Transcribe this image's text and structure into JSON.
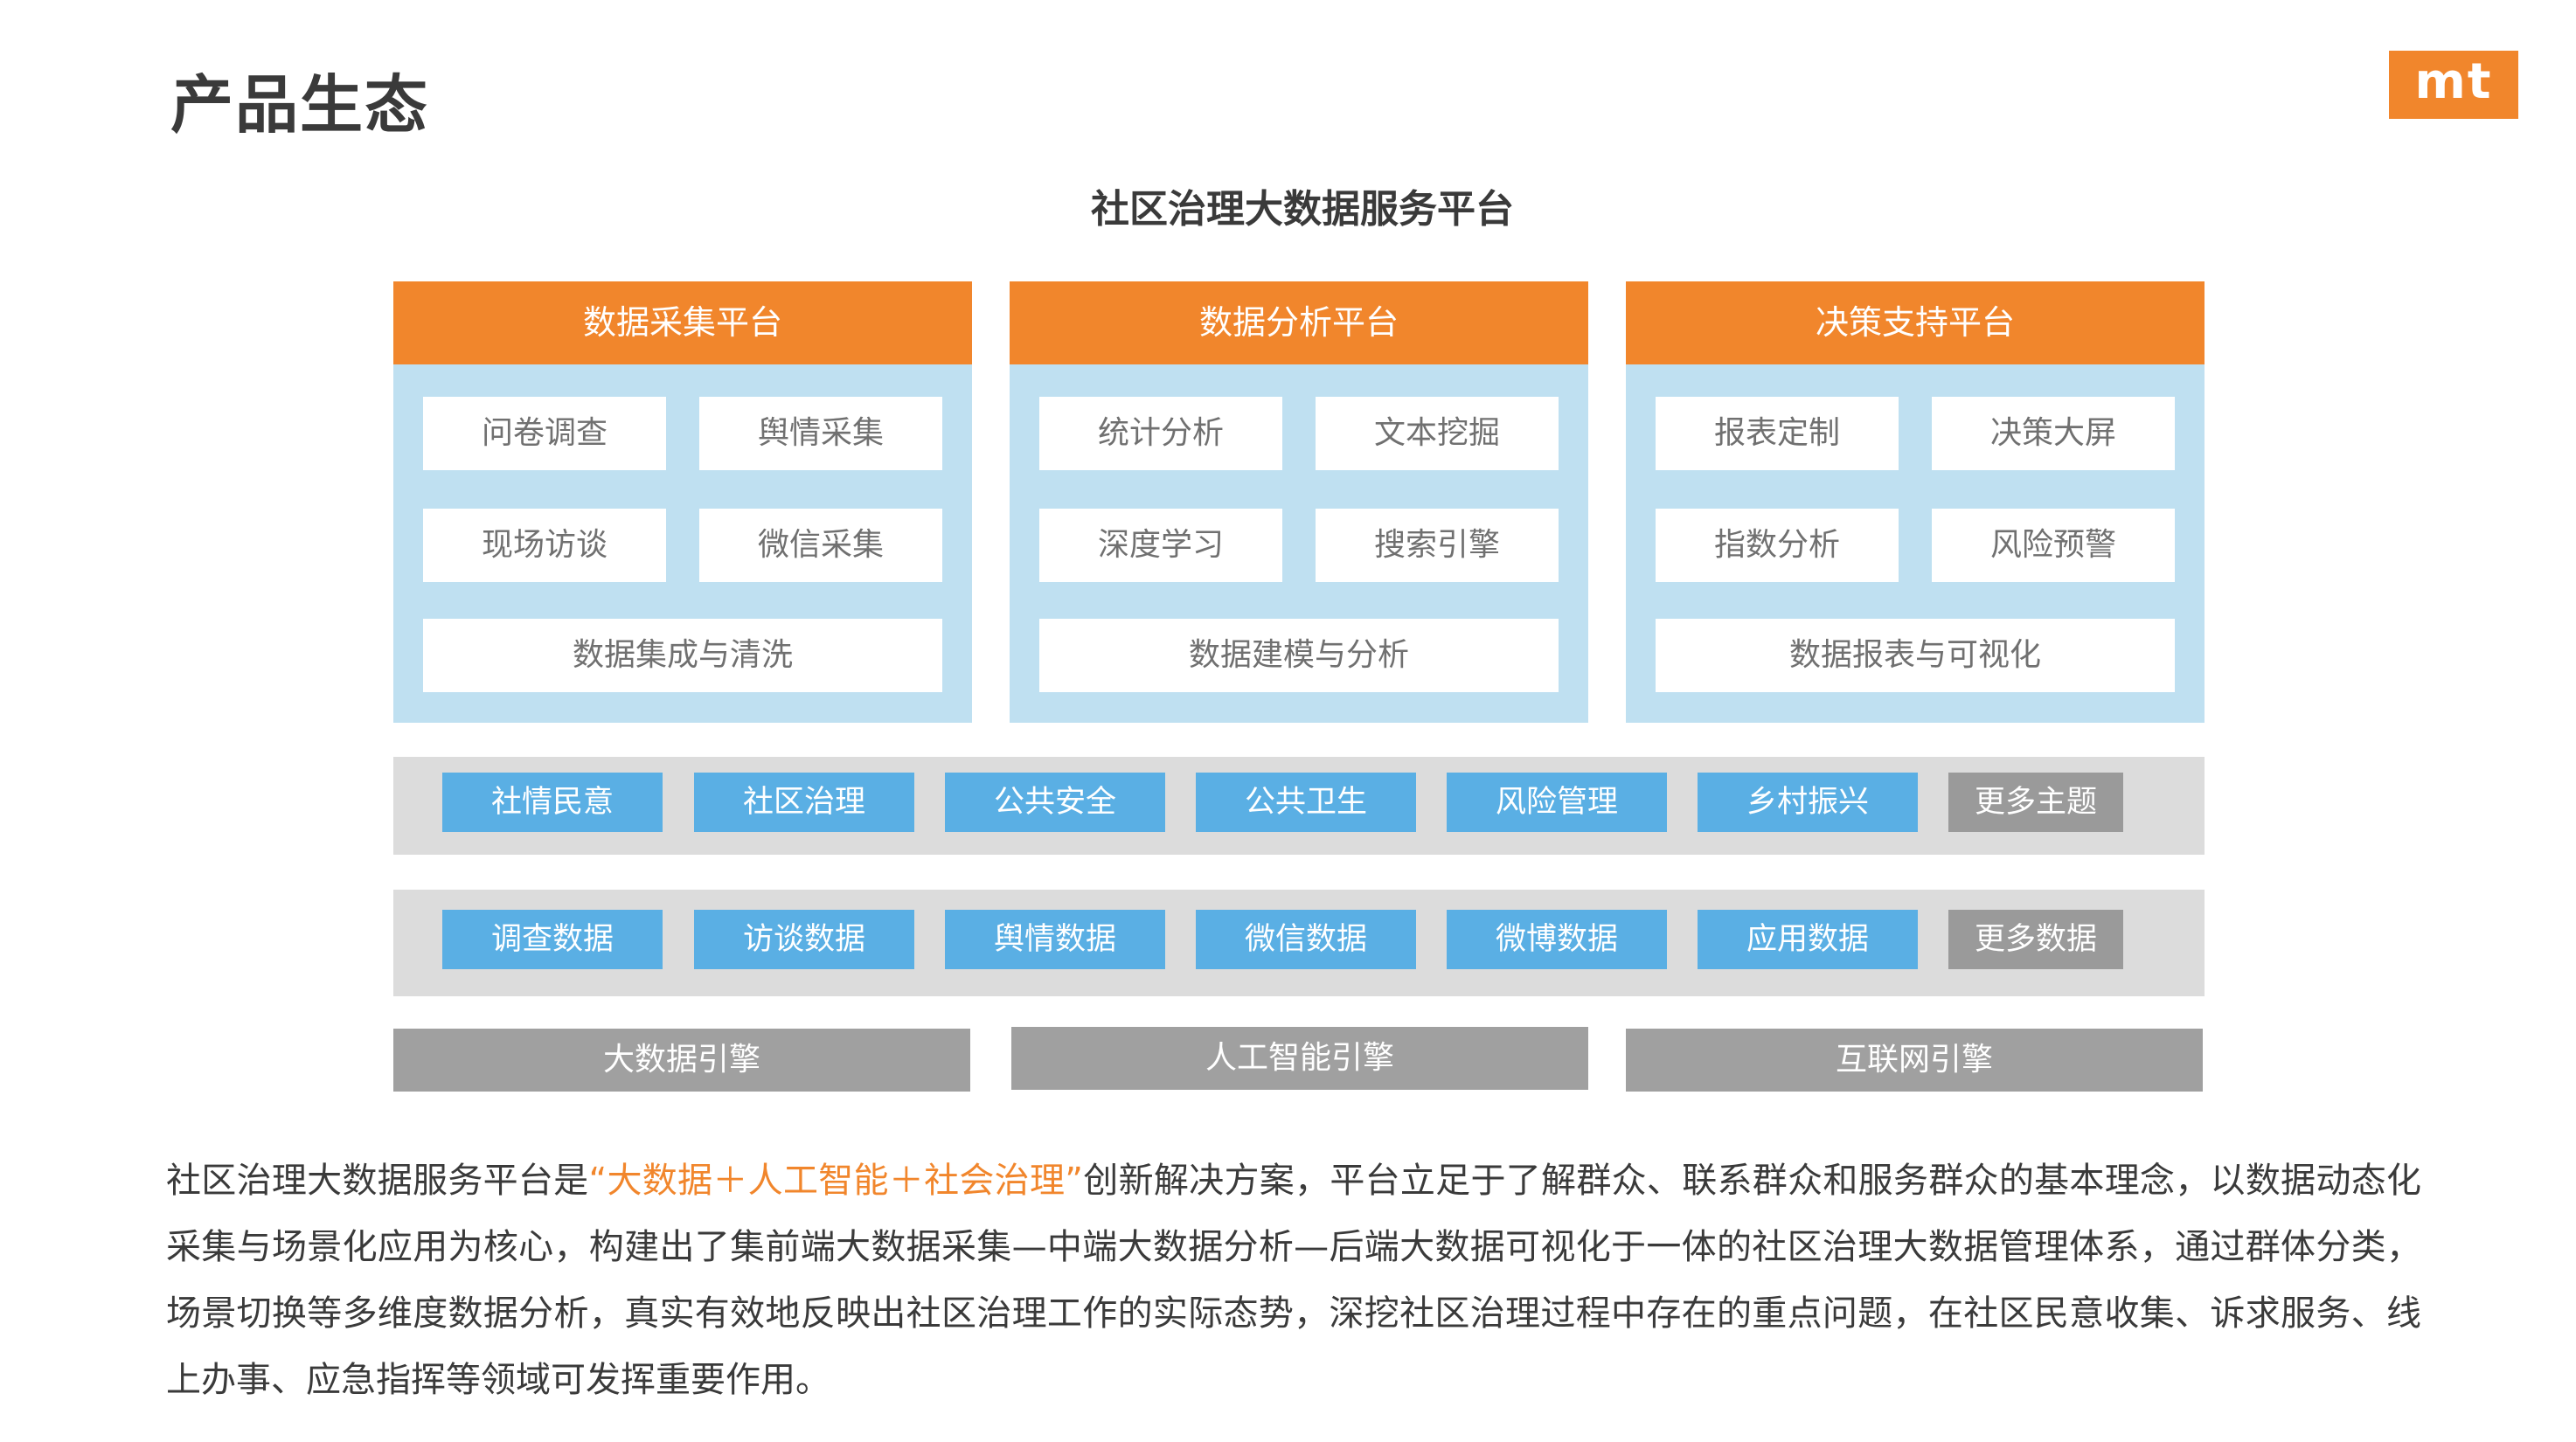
{
  "page_title": "产品生态",
  "logo_text": "mt",
  "diagram_title": "社区治理大数据服务平台",
  "platforms": [
    {
      "title": "数据采集平台",
      "items": [
        "问卷调查",
        "舆情采集",
        "现场访谈",
        "微信采集"
      ],
      "wide_item": "数据集成与清洗"
    },
    {
      "title": "数据分析平台",
      "items": [
        "统计分析",
        "文本挖掘",
        "深度学习",
        "搜索引擎"
      ],
      "wide_item": "数据建模与分析"
    },
    {
      "title": "决策支持平台",
      "items": [
        "报表定制",
        "决策大屏",
        "指数分析",
        "风险预警"
      ],
      "wide_item": "数据报表与可视化"
    }
  ],
  "topics": [
    "社情民意",
    "社区治理",
    "公共安全",
    "公共卫生",
    "风险管理",
    "乡村振兴",
    "更多主题"
  ],
  "data_sources": [
    "调查数据",
    "访谈数据",
    "舆情数据",
    "微信数据",
    "微博数据",
    "应用数据",
    "更多数据"
  ],
  "engines": [
    "大数据引擎",
    "人工智能引擎",
    "互联网引擎"
  ],
  "description": {
    "part1": "社区治理大数据服务平台是",
    "highlight": "“大数据＋人工智能＋社会治理”",
    "part2": "创新解决方案，平台立足于了解群众、联系群众和服务群众的基本理念，以数据动态化采集与场景化应用为核心，构建出了集前端大数据采集—中端大数据分析—后端大数据可视化于一体的社区治理大数据管理体系，通过群体分类，场景切换等多维度数据分析，真实有效地反映出社区治理工作的实际态势，深挖社区治理过程中存在的重点问题，在社区民意收集、诉求服务、线上办事、应急指挥等领域可发挥重要作用。"
  },
  "colors": {
    "accent_orange": "#f1862c",
    "panel_blue": "#bfe0f1",
    "chip_blue": "#5aafe4",
    "band_gray": "#dcdcdc",
    "engine_gray": "#a0a0a0"
  }
}
